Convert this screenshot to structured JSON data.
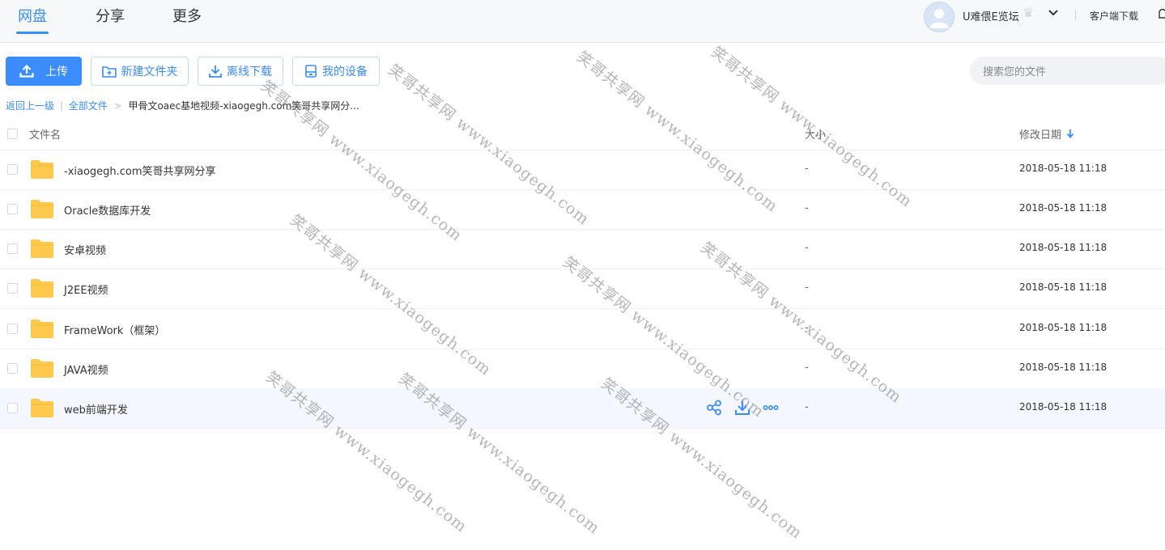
{
  "nav": {
    "tabs": [
      "网盘",
      "分享",
      "更多"
    ],
    "username": "U难偎E览坛",
    "client_download": "客户端下载"
  },
  "toolbar": {
    "upload": "上传",
    "new_folder": "新建文件夹",
    "offline_download": "离线下载",
    "my_devices": "我的设备",
    "search_placeholder": "搜索您的文件"
  },
  "breadcrumb": {
    "back": "返回上一级",
    "divider": "|",
    "all_files": "全部文件",
    "separator": ">",
    "current": "甲骨文oaec基地视频-xiaogegh.com笑哥共享网分..."
  },
  "table": {
    "headers": {
      "name": "文件名",
      "size": "大小",
      "date": "修改日期"
    },
    "rows": [
      {
        "name": "-xiaogegh.com笑哥共享网分享",
        "size": "-",
        "date": "2018-05-18 11:18"
      },
      {
        "name": "Oracle数据库开发",
        "size": "-",
        "date": "2018-05-18 11:18"
      },
      {
        "name": "安卓视频",
        "size": "-",
        "date": "2018-05-18 11:18"
      },
      {
        "name": "J2EE视频",
        "size": "-",
        "date": "2018-05-18 11:18"
      },
      {
        "name": "FrameWork（框架）",
        "size": "-",
        "date": "2018-05-18 11:18"
      },
      {
        "name": "JAVA视频",
        "size": "-",
        "date": "2018-05-18 11:18"
      },
      {
        "name": "web前端开发",
        "size": "-",
        "date": "2018-05-18 11:18"
      }
    ]
  },
  "watermark": "笑哥共享网 www.xiaogegh.com",
  "colors": {
    "accent": "#3b8cff",
    "folder": "#ffc94d",
    "hover_row": "#f4f8fe"
  }
}
